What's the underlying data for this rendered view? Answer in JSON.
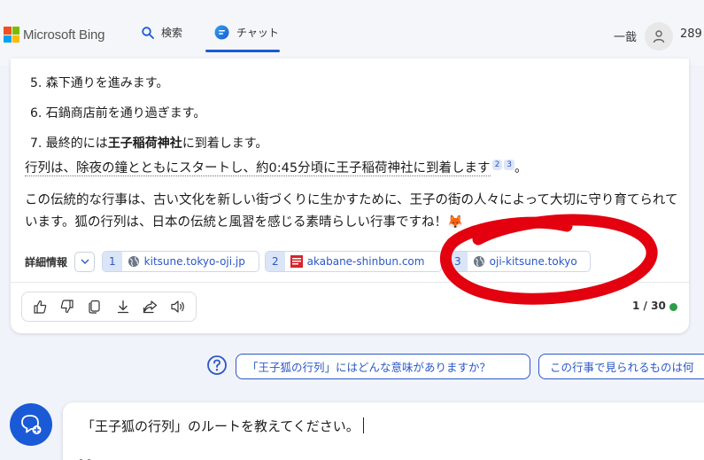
{
  "header": {
    "brand": "Microsoft Bing",
    "tabs": [
      {
        "label": "検索",
        "icon": "search-icon"
      },
      {
        "label": "チャット",
        "icon": "chat-icon",
        "active": true
      }
    ],
    "user_name": "一戠",
    "points": "289"
  },
  "answer": {
    "steps": [
      "5. 森下通りを進みます。",
      "6. 石鍋商店前を通り過ぎます。"
    ],
    "step7_prefix": "7. 最終的には",
    "step7_bold": "王子稲荷神社",
    "step7_suffix": "に到着します。",
    "summary_text": "行列は、除夜の鐘とともにスタートし、約0:45分頃に王子稲荷神社に到着します",
    "summary_cites": [
      "2",
      "3"
    ],
    "summary_end": "。",
    "paragraph": "この伝統的な行事は、古い文化を新しい街づくりに生かすために、王子の街の人々によって大切に守り育てられています。狐の行列は、日本の伝統と風習を感じる素晴らしい行事ですね！🦊",
    "details_label": "詳細情報",
    "sources": [
      {
        "num": "1",
        "domain": "kitsune.tokyo-oji.jp",
        "icon": "globe-icon"
      },
      {
        "num": "2",
        "domain": "akabane-shinbun.com",
        "icon": "site-favicon"
      },
      {
        "num": "3",
        "domain": "oji-kitsune.tokyo",
        "icon": "globe-icon"
      }
    ],
    "counter": "1 / 30",
    "status_color": "#2a9d49"
  },
  "suggestions": [
    "「王子狐の行列」にはどんな意味がありますか？",
    "この行事で見られるものは何"
  ],
  "input": {
    "value": "「王子狐の行列」のルートを教えてください。"
  },
  "colors": {
    "accent": "#1a5ad6",
    "annotation": "#e3000f"
  }
}
